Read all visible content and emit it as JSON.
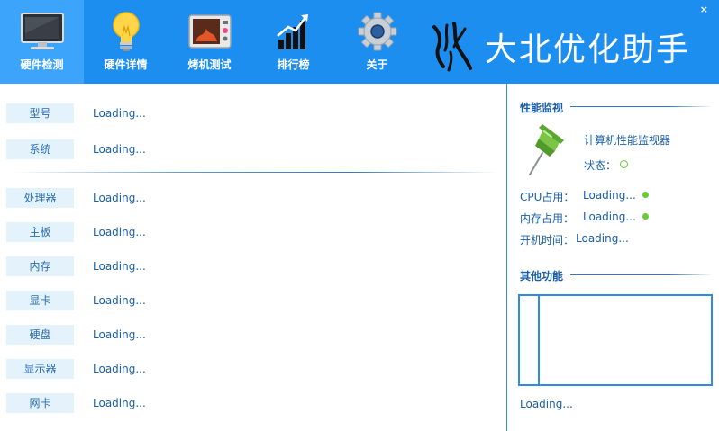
{
  "app": {
    "brand_title": "大北优化助手",
    "close_label": "×",
    "accent_color": "#1b8ef0",
    "active_tab_color": "#3da4fb"
  },
  "nav": {
    "items": [
      {
        "label": "硬件检测",
        "icon": "monitor-icon",
        "active": true
      },
      {
        "label": "硬件详情",
        "icon": "lightbulb-icon",
        "active": false
      },
      {
        "label": "烤机测试",
        "icon": "oven-icon",
        "active": false
      },
      {
        "label": "排行榜",
        "icon": "bar-chart-icon",
        "active": false
      },
      {
        "label": "关于",
        "icon": "gear-icon",
        "active": false
      }
    ]
  },
  "summary": {
    "rows": [
      {
        "label": "型号",
        "value": "Loading..."
      },
      {
        "label": "系统",
        "value": "Loading..."
      }
    ]
  },
  "hardware": {
    "rows": [
      {
        "label": "处理器",
        "value": "Loading..."
      },
      {
        "label": "主板",
        "value": "Loading..."
      },
      {
        "label": "内存",
        "value": "Loading..."
      },
      {
        "label": "显卡",
        "value": "Loading..."
      },
      {
        "label": "硬盘",
        "value": "Loading..."
      },
      {
        "label": "显示器",
        "value": "Loading..."
      },
      {
        "label": "网卡",
        "value": "Loading..."
      }
    ]
  },
  "monitor": {
    "title": "性能监视",
    "name": "计算机性能监视器",
    "status_label": "状态：",
    "status_color": "#66cc33",
    "cpu_label": "CPU占用：",
    "cpu_value": "Loading...",
    "mem_label": "内存占用：",
    "mem_value": "Loading...",
    "uptime_label": "开机时间：",
    "uptime_value": "Loading...",
    "indicator_color": "#66cc33"
  },
  "other": {
    "title": "其他功能",
    "status": "Loading..."
  }
}
